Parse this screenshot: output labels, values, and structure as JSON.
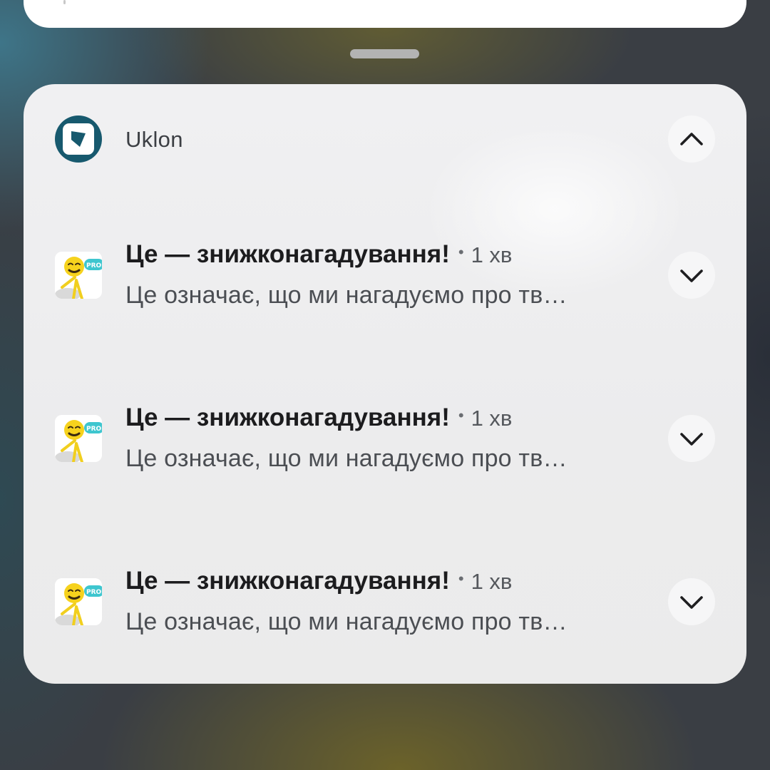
{
  "group": {
    "app_name": "Uklon",
    "app_icon": "uklon-logo-icon",
    "collapse_icon": "chevron-up-icon"
  },
  "notifications": [
    {
      "title": "Це — знижконагадування!",
      "separator": "•",
      "time": "1 хв",
      "body": "Це означає, що ми нагадуємо про тв…",
      "thumbnail_icon": "promo-character-icon",
      "expand_icon": "chevron-down-icon"
    },
    {
      "title": "Це — знижконагадування!",
      "separator": "•",
      "time": "1 хв",
      "body": "Це означає, що ми нагадуємо про тв…",
      "thumbnail_icon": "promo-character-icon",
      "expand_icon": "chevron-down-icon"
    },
    {
      "title": "Це — знижконагадування!",
      "separator": "•",
      "time": "1 хв",
      "body": "Це означає, що ми нагадуємо про тв…",
      "thumbnail_icon": "promo-character-icon",
      "expand_icon": "chevron-down-icon"
    }
  ],
  "colors": {
    "brand": "#17596e",
    "panel_background": "#ececed",
    "title_text": "#1c1c1e",
    "body_text": "#4b4e53"
  },
  "thumbnail_badge_text": "PROMO"
}
